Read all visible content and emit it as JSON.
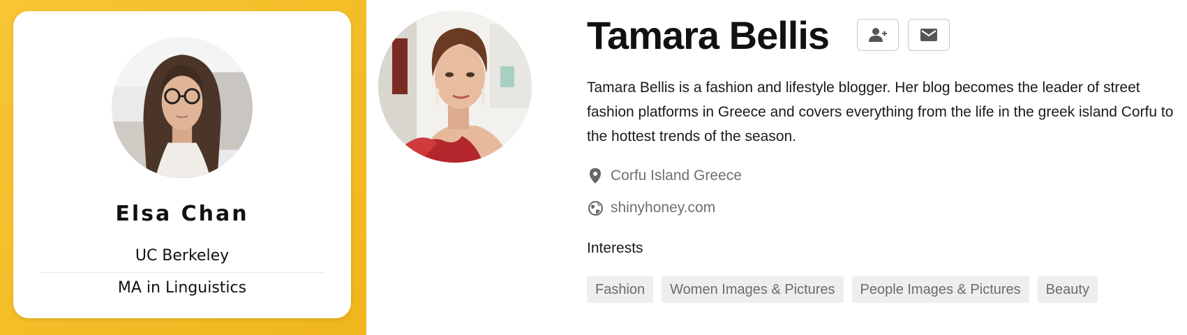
{
  "student_card": {
    "name": "Elsa Chan",
    "school": "UC Berkeley",
    "degree": "MA in Linguistics",
    "avatar": "photo-woman-glasses"
  },
  "profile": {
    "name": "Tamara Bellis",
    "avatar": "photo-woman-red-dress",
    "actions": [
      {
        "icon": "add-user-icon"
      },
      {
        "icon": "envelope-icon"
      }
    ],
    "bio": "Tamara Bellis is a fashion and lifestyle blogger. Her blog becomes the leader of street fashion platforms in Greece and covers everything from the life in the greek island Corfu to the hottest trends of the season.",
    "location": "Corfu Island Greece",
    "website": "shinyhoney.com",
    "interests_heading": "Interests",
    "interests": [
      "Fashion",
      "Women Images & Pictures",
      "People Images & Pictures",
      "Beauty"
    ]
  },
  "colors": {
    "panel_yellow": "#f4bd25",
    "text_dark": "#111111",
    "text_muted": "#6f6f6f",
    "tag_bg": "#eeeeee"
  }
}
